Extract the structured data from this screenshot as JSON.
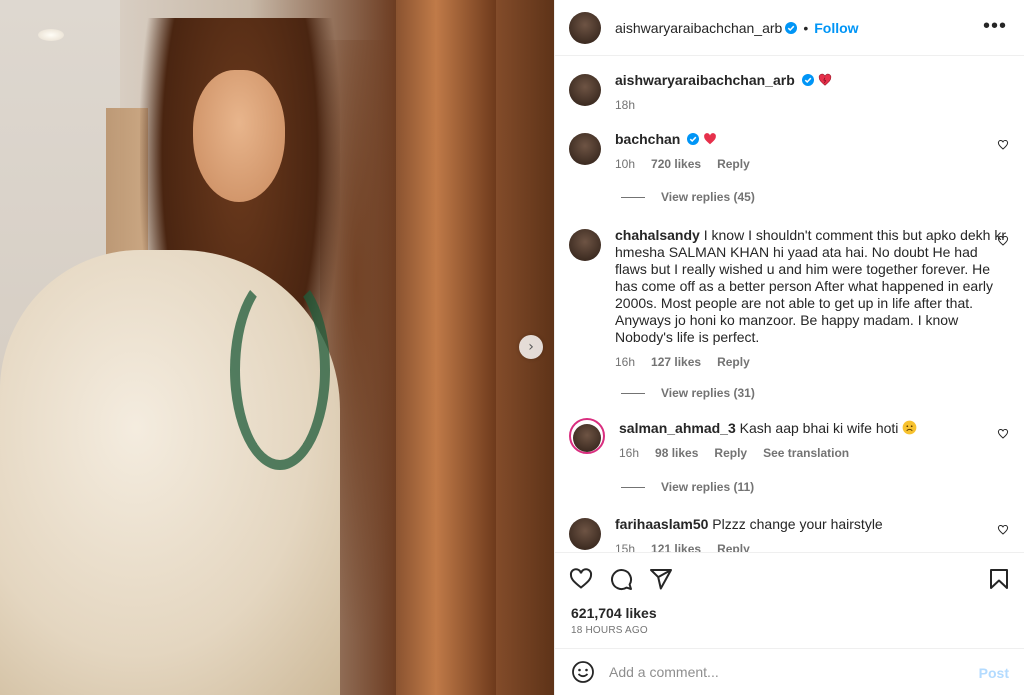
{
  "header": {
    "username": "aishwaryaraibachchan_arb",
    "separator": "•",
    "follow_label": "Follow",
    "more_label": "•••"
  },
  "caption": {
    "username": "aishwaryaraibachchan_arb",
    "emoji": "heart-emoji",
    "time": "18h"
  },
  "comments": [
    {
      "username": "bachchan",
      "verified": true,
      "text": "",
      "time": "10h",
      "likes": "720 likes",
      "reply": "Reply",
      "view_replies": "View replies (45)"
    },
    {
      "username": "chahalsandy",
      "text": "I know I shouldn't comment this but apko dekh kr hmesha SALMAN KHAN hi yaad ata hai. No doubt He had flaws but I really wished u and him were together forever. He has come off as a better person After what happened in early 2000s. Most people are not able to get up in life after that. Anyways jo honi ko manzoor. Be happy madam. I know Nobody's life is perfect.",
      "time": "16h",
      "likes": "127 likes",
      "reply": "Reply",
      "view_replies": "View replies (31)"
    },
    {
      "username": "salman_ahmad_3",
      "text": "Kash aap bhai ki wife hoti",
      "time": "16h",
      "likes": "98 likes",
      "reply": "Reply",
      "see_translation": "See translation",
      "view_replies": "View replies (11)"
    },
    {
      "username": "farihaaslam50",
      "text": "Plzzz change your hairstyle",
      "time": "15h",
      "likes": "121 likes",
      "reply": "Reply"
    }
  ],
  "actions": {
    "likes": "621,704 likes",
    "posted": "18 HOURS AGO"
  },
  "add_comment": {
    "placeholder": "Add a comment...",
    "post_label": "Post"
  },
  "colors": {
    "accent": "#0095f6",
    "post_disabled": "#b3dbff",
    "heart": "#ed4956",
    "muted": "#737373"
  },
  "icons": [
    "heart-icon",
    "comment-icon",
    "share-icon",
    "bookmark-icon",
    "emoji-icon",
    "verified-icon",
    "chevron-right-icon",
    "more-icon"
  ]
}
